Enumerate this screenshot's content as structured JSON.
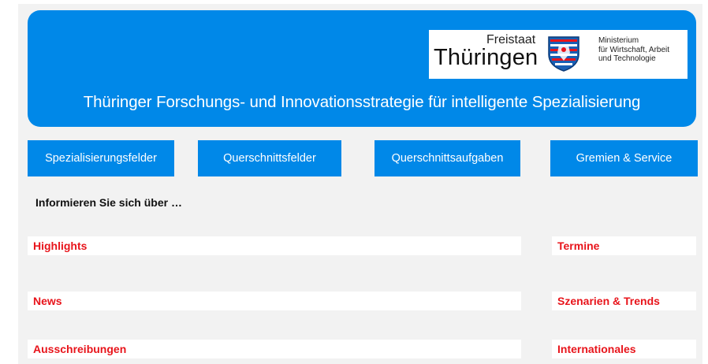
{
  "header": {
    "title": "Thüringer Forschungs- und Innovationsstrategie für intelligente Spezialisierung",
    "logo": {
      "freistaat": "Freistaat",
      "thueringen": "Thüringen",
      "ministry_lines": [
        "Ministerium",
        "für Wirtschaft, Arbeit",
        "und Technologie"
      ],
      "crest_icon": "thuringia-coat-of-arms-icon"
    }
  },
  "nav": [
    {
      "label": "Spezialisierungsfelder"
    },
    {
      "label": "Querschnittsfelder"
    },
    {
      "label": "Querschnittsaufgaben"
    },
    {
      "label": "Gremien & Service"
    }
  ],
  "intro": "Informieren Sie sich über …",
  "sections": {
    "highlights": "Highlights",
    "termine": "Termine",
    "news": "News",
    "szenarien": "Szenarien & Trends",
    "ausschreibungen": "Ausschreibungen",
    "internationales": "Internationales"
  },
  "colors": {
    "brand_blue": "#0088e8",
    "section_red": "#e8141b",
    "background": "#f2f2f2"
  }
}
